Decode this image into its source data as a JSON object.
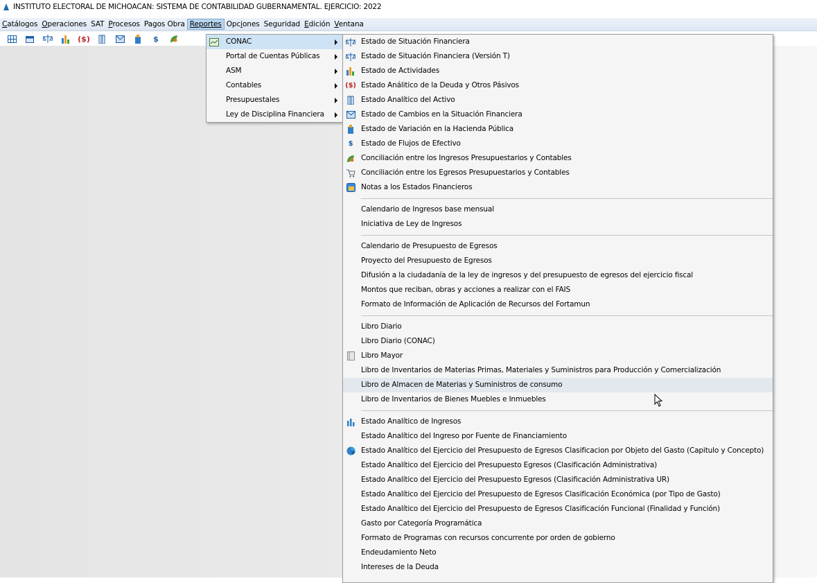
{
  "window": {
    "title": "INSTITUTO ELECTORAL DE MICHOACAN: SISTEMA DE CONTABILIDAD GUBERNAMENTAL. EJERCICIO: 2022"
  },
  "menubar": {
    "catalogos": "Catálogos",
    "operaciones": "Operaciones",
    "sat": "SAT",
    "procesos": "Procesos",
    "pagos_obra": "Pagos Obra",
    "reportes": "Reportes",
    "opciones": "Opciones",
    "seguridad": "Seguridad",
    "edicion": "Edición",
    "ventana": "Ventana"
  },
  "toolbar": {
    "icons": [
      "grid-icon",
      "calendar-icon",
      "balance-icon",
      "bar-chart-icon",
      "debt-icon",
      "building-icon",
      "mail-chart-icon",
      "hacienda-icon",
      "dollar-icon",
      "leaf-icon"
    ],
    "debt_glyph": "($)",
    "dollar_glyph": "$"
  },
  "reportes_menu": {
    "conac": "CONAC",
    "portal": "Portal de Cuentas Públicas",
    "asm": "ASM",
    "contables": "Contables",
    "presupuestales": "Presupuestales",
    "ley_disciplina": "Ley de Disciplina Financiera"
  },
  "conac_menu": {
    "group1": [
      "Estado de Situación Financiera",
      "Estado de Situación Financiera (Versión T)",
      "Estado de Actividades",
      "Estado Análitico de la Deuda y Otros Pásivos",
      "Estado Analítico del Activo",
      "Estado de Cambios en la Situación Financiera",
      "Estado de Variación en la Hacienda Pública",
      "Estado de Flujos de Efectivo",
      "Conciliación entre los Ingresos Presupuestarios y Contables",
      "Conciliación entre los Egresos Presupuestarios y Contables",
      "Notas a los Estados Financieros"
    ],
    "group2": [
      "Calendario de Ingresos base mensual",
      "Iniciativa de Ley de Ingresos"
    ],
    "group3": [
      "Calendario de Presupuesto de Egresos",
      "Proyecto del Presupuesto de Egresos",
      "Difusión a la ciudadanía de la ley de ingresos y del presupuesto de egresos del ejercicio fiscal",
      "Montos que reciban, obras y acciones a realizar con el FAIS",
      "Formato de Información de Aplicación de Recursos del Fortamun"
    ],
    "group4": [
      "Libro Diario",
      "Libro Diario (CONAC)",
      "Libro Mayor",
      "Libro de Inventarios de Materias Primas, Materiales y Suministros para Producción y Comercialización",
      "Libro de Almacen de Materias y Suministros de consumo",
      "Libro de Inventarios de Bienes Muebles e Inmuebles"
    ],
    "group5": [
      "Estado Analítico de Ingresos",
      "Estado Analítico del Ingreso por Fuente de Financiamiento",
      "Estado Analítico del Ejercicio del Presupuesto de Egresos Clasificacion por Objeto del Gasto (Capitulo y Concepto)",
      "Estado Analítico del Ejercicio del Presupuesto Egresos (Clasificación Administrativa)",
      "Estado Analítico del Ejercicio del Presupuesto Egresos (Clasificación Administrativa UR)",
      "Estado Analítico del Ejercicio del Presupuesto de Egresos Clasificación Económica (por Tipo de Gasto)",
      "Estado Analítico del Ejercicio del Presupuesto de Egresos Clasificación Funcional (Finalidad y Función)",
      "Gasto por Categoría Programática",
      "Formato de Programas con recursos concurrente por orden de gobierno",
      "Endeudamiento Neto",
      "Intereses de la Deuda"
    ]
  }
}
